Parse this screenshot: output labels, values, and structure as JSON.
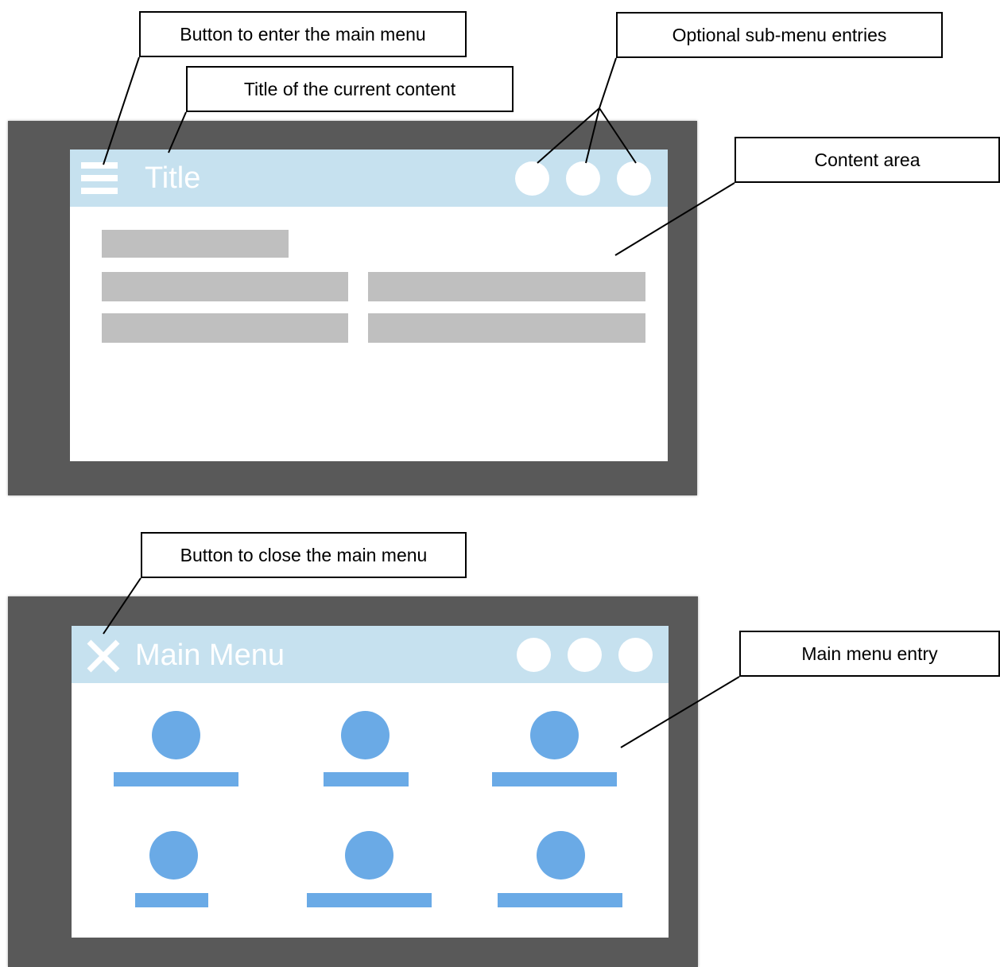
{
  "callouts": {
    "enter_menu": "Button to enter the main menu",
    "title_content": "Title of the current content",
    "sub_menu": "Optional sub-menu entries",
    "content_area": "Content area",
    "close_menu": "Button to close the main menu",
    "menu_entry": "Main menu entry"
  },
  "screen1": {
    "title": "Title",
    "menu_icon": "hamburger-icon"
  },
  "screen2": {
    "title": "Main Menu",
    "close_icon": "close-icon"
  },
  "colors": {
    "device": "#595959",
    "appbar": "#c6e1ef",
    "placeholder": "#bfbfbf",
    "menu_entry": "#6aaae6"
  }
}
